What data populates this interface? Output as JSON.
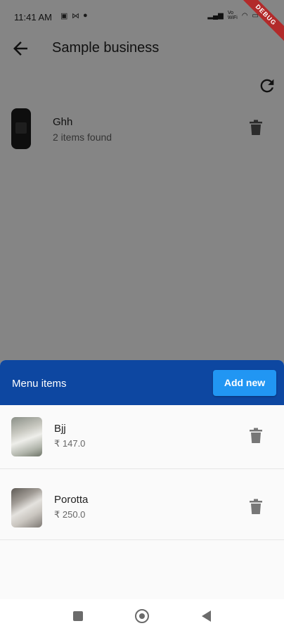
{
  "status_bar": {
    "time": "11:41 AM",
    "notification_icons": [
      "chat-icon",
      "mail-icon",
      "messenger-icon"
    ],
    "network_label": "Vo WiFi",
    "battery_icon": "battery-icon"
  },
  "debug_banner": "DEBUG",
  "app_bar": {
    "back_icon": "arrow-back-icon",
    "title": "Sample business",
    "refresh_icon": "refresh-icon"
  },
  "business": {
    "name": "Ghh",
    "item_count": "2 items found",
    "delete_icon": "trash-icon"
  },
  "sheet": {
    "title": "Menu items",
    "add_label": "Add new",
    "items": [
      {
        "name": "Bjj",
        "price": "₹ 147.0",
        "delete_icon": "trash-icon"
      },
      {
        "name": "Porotta",
        "price": "₹ 250.0",
        "delete_icon": "trash-icon"
      }
    ]
  },
  "nav_bar": {
    "recents_icon": "square-icon",
    "home_icon": "circle-icon",
    "back_icon": "triangle-back-icon"
  },
  "colors": {
    "sheet_header": "#0d47a1",
    "add_button": "#2196f3",
    "scrim": "rgba(0,0,0,0.48)",
    "debug_banner": "#b22a2a"
  }
}
